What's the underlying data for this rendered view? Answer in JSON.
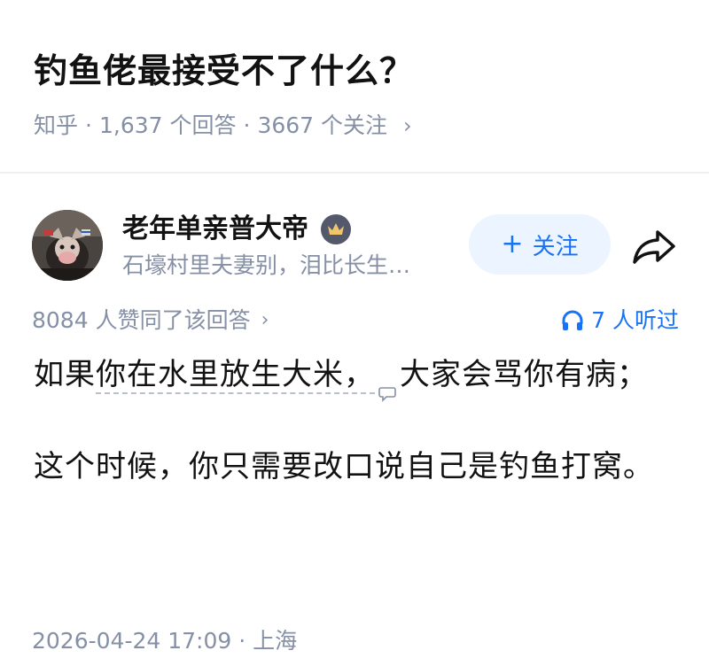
{
  "question": {
    "title": "钓鱼佬最接受不了什么？",
    "source": "知乎",
    "answer_count": "1,637 个回答",
    "follower_count": "3667 个关注",
    "separator": "·",
    "chevron": "›"
  },
  "author": {
    "name": "老年单亲普大帝",
    "bio": "石壕村里夫妻别，泪比长生…",
    "badge_icon": "crown-icon",
    "follow_label": "关注",
    "follow_plus": "+",
    "share_icon": "share-arrow-icon"
  },
  "stats": {
    "likes": "8084 人赞同了该回答",
    "chevron": "›",
    "listen": "7 人听过",
    "listen_icon": "headphones-icon"
  },
  "content": {
    "p1_part1": "如果",
    "p1_dashed": "你在水里放生大米，",
    "p1_part2": "大家会骂你有病；",
    "p2": "这个时候，你只需要改口说自己是钓鱼打窝。"
  },
  "footer": {
    "timestamp": "2026-04-24 17:09",
    "separator": "·",
    "location": "上海"
  },
  "colors": {
    "accent": "#1772f6",
    "follow_bg": "#ebf4ff",
    "meta_gray": "#8590a6",
    "text": "#121212"
  }
}
